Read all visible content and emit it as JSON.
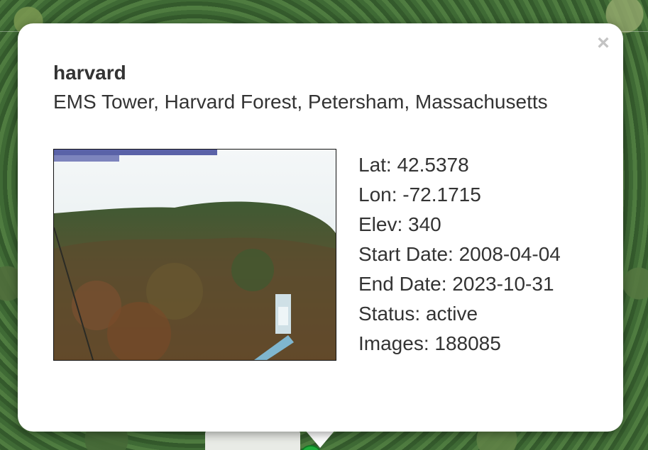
{
  "popup": {
    "close_label": "×",
    "site_name": "harvard",
    "site_description": "EMS Tower, Harvard Forest, Petersham, Massachusetts",
    "details": [
      {
        "label": "Lat",
        "value": "42.5378"
      },
      {
        "label": "Lon",
        "value": "-72.1715"
      },
      {
        "label": "Elev",
        "value": "340"
      },
      {
        "label": "Start Date",
        "value": "2008-04-04"
      },
      {
        "label": "End Date",
        "value": "2023-10-31"
      },
      {
        "label": "Status",
        "value": "active"
      },
      {
        "label": "Images",
        "value": "188085"
      }
    ],
    "detail_lines": [
      "Lat: 42.5378",
      "Lon: -72.1715",
      "Elev: 340",
      "Start Date: 2008-04-04",
      "End Date: 2023-10-31",
      "Status: active",
      "Images: 188085"
    ]
  },
  "icons": {
    "close": "close-icon",
    "marker": "map-marker-icon"
  },
  "colors": {
    "popup_background": "#ffffff",
    "text": "#333333",
    "close_icon": "#c3c3c3",
    "marker": "#1fae3a"
  }
}
